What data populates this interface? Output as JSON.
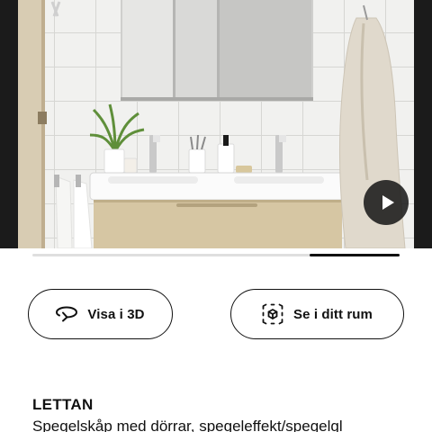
{
  "hero": {
    "play_icon": "play-icon",
    "carousel_progress": {
      "start": 0.755,
      "end": 1.0
    }
  },
  "actions": {
    "view_3d_label": "Visa i 3D",
    "view_3d_icon": "rotate-3d-icon",
    "ar_label": "Se i ditt rum",
    "ar_icon": "ar-cube-icon"
  },
  "product": {
    "name": "LETTAN",
    "description": "Spegelskåp med dörrar, spegeleffekt/spegelgl"
  },
  "colors": {
    "text": "#111111",
    "progress_track": "#dfdfdf",
    "progress_fill": "#111111",
    "play_bg": "#1b1b1b"
  }
}
